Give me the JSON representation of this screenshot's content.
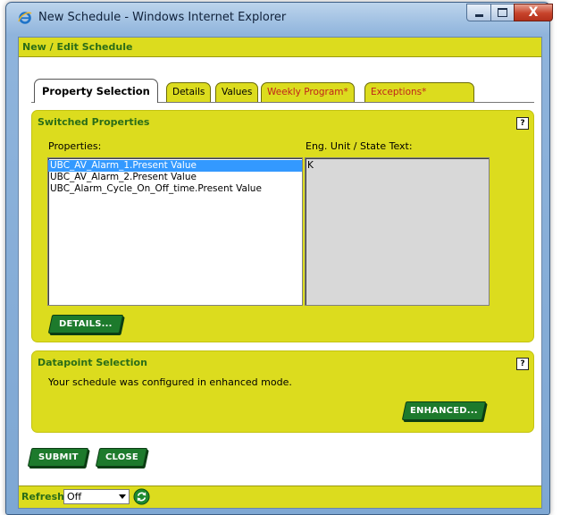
{
  "window": {
    "title": "New Schedule - Windows Internet Explorer",
    "close_glyph": "X"
  },
  "form": {
    "header": "New / Edit Schedule",
    "tabs": [
      {
        "label": "Property Selection",
        "active": true
      },
      {
        "label": "Details",
        "active": false
      },
      {
        "label": "Values",
        "active": false
      },
      {
        "label": "Weekly Program*",
        "active": false,
        "color": "#c0241b"
      },
      {
        "label": "Exceptions*",
        "active": false,
        "color": "#c0241b"
      }
    ]
  },
  "switched_properties": {
    "title": "Switched Properties",
    "help": "?",
    "properties_label": "Properties:",
    "properties": [
      "UBC_AV_Alarm_1.Present Value",
      "UBC_AV_Alarm_2.Present Value",
      "UBC_Alarm_Cycle_On_Off_time.Present Value"
    ],
    "selected_index": 0,
    "unit_label": "Eng. Unit / State Text:",
    "unit_items": [
      "K"
    ],
    "details_button": "DETAILS..."
  },
  "datapoint_selection": {
    "title": "Datapoint Selection",
    "help": "?",
    "message": "Your schedule was configured in enhanced mode.",
    "enhanced_button": "ENHANCED..."
  },
  "actions": {
    "submit": "SUBMIT",
    "close": "CLOSE"
  },
  "refresh": {
    "label": "Refresh:",
    "value": "Off"
  },
  "colors": {
    "panel_yellow": "#dcdc1e",
    "heading_green": "#2b6d17",
    "button_green": "#1d7a2c",
    "tab_red": "#c0241b",
    "selection_blue": "#3399ff"
  },
  "icons": {
    "browser": "internet-explorer-icon",
    "refresh": "refresh-icon",
    "help": "help-icon",
    "dropdown": "chevron-down-icon"
  }
}
